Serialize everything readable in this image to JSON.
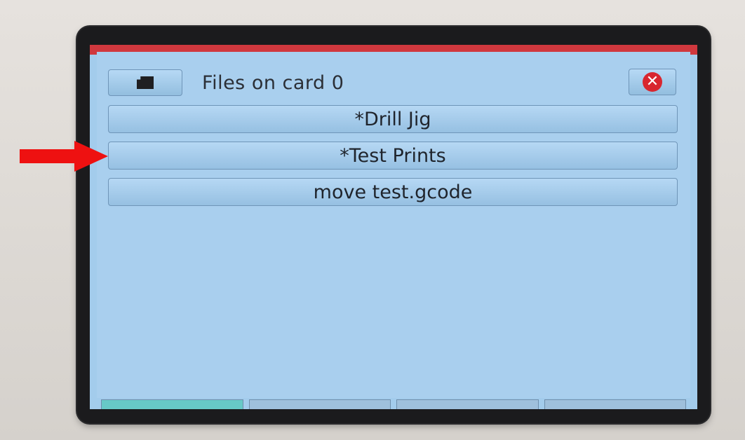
{
  "dialog": {
    "title": "Files on card 0",
    "sd_icon": "sd-card-icon",
    "close_icon": "close-icon"
  },
  "files": [
    {
      "label": "*Drill Jig"
    },
    {
      "label": "*Test Prints"
    },
    {
      "label": "move test.gcode"
    }
  ],
  "colors": {
    "screen_bg": "#a3ccec",
    "button_border": "#6f95b8",
    "close_red": "#d8262f",
    "arrow_red": "#ee1111",
    "header_red": "#d0383e"
  }
}
